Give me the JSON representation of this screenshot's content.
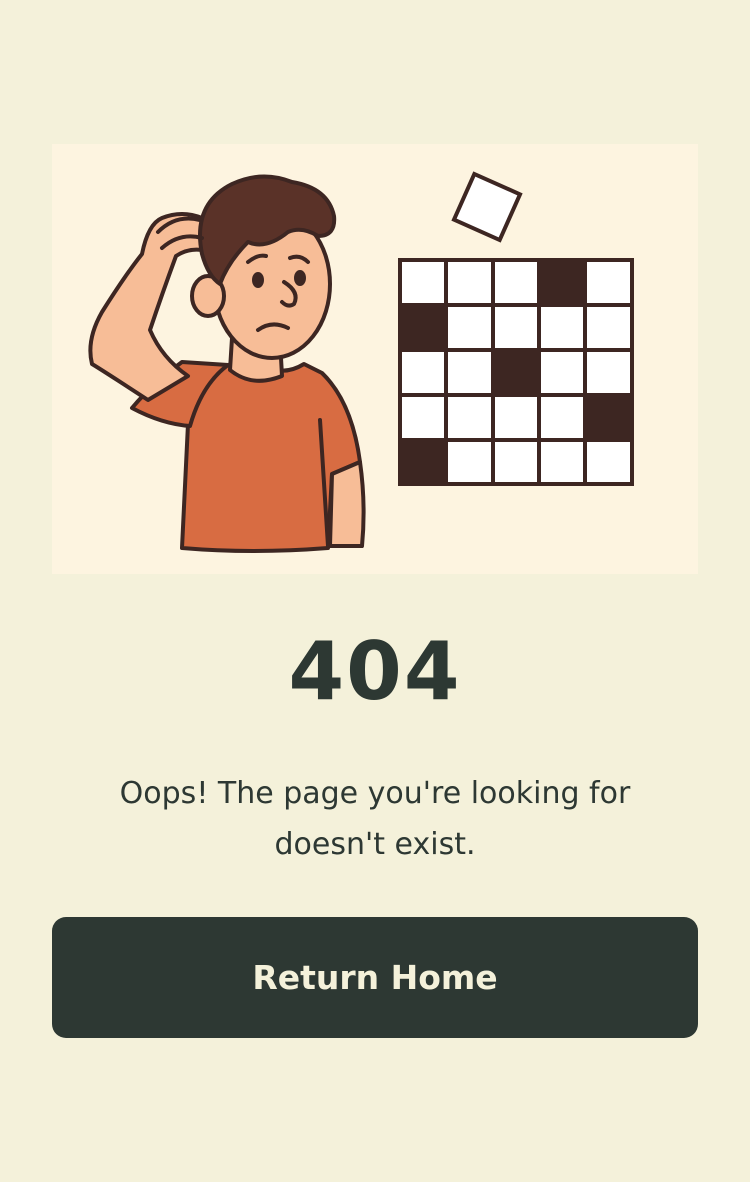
{
  "error": {
    "code": "404",
    "message": "Oops! The page you're looking for doesn't exist."
  },
  "actions": {
    "return_home_label": "Return Home"
  },
  "colors": {
    "background": "#f4f1da",
    "illustration_background": "#fdf4e0",
    "text": "#2d3833",
    "button_background": "#2d3833",
    "button_text": "#f4f1da",
    "shirt": "#d86c42",
    "skin": "#f7bd97",
    "outline": "#3d2622"
  },
  "illustration": {
    "subject": "confused-person-with-crossword-icon"
  }
}
